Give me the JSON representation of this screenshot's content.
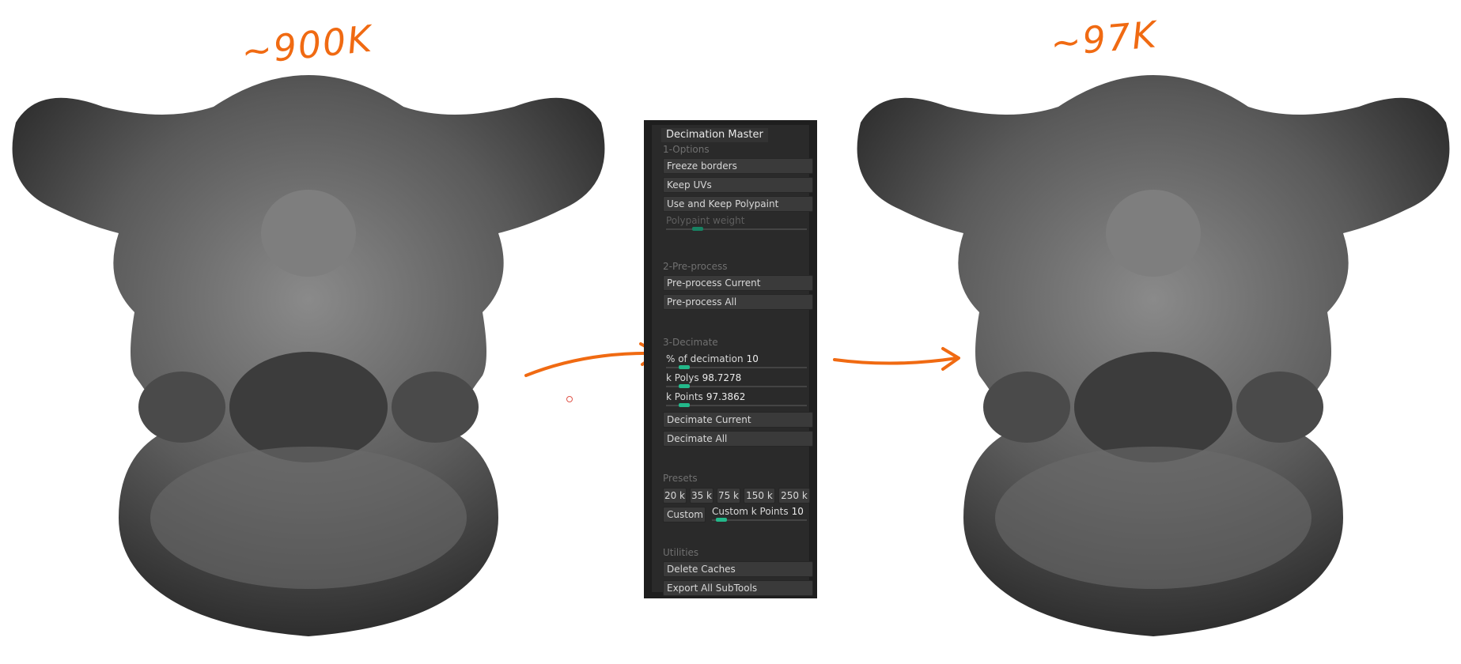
{
  "annotations": {
    "left": "~900K",
    "right": "~97K"
  },
  "colors": {
    "annotation": "#f06a12",
    "panel_bg": "#1e1e1e",
    "slider_accent": "#23b88a"
  },
  "panel": {
    "title": "Decimation Master",
    "sections": {
      "options": {
        "label": "1-Options",
        "freeze_borders": "Freeze borders",
        "keep_uvs": "Keep UVs",
        "use_keep_polypaint": "Use and Keep Polypaint",
        "polypaint_weight": "Polypaint weight"
      },
      "preprocess": {
        "label": "2-Pre-process",
        "current": "Pre-process Current",
        "all": "Pre-process All"
      },
      "decimate": {
        "label": "3-Decimate",
        "percent_label": "% of decimation",
        "percent_value": "10",
        "kpolys_label": "k Polys",
        "kpolys_value": "98.7278",
        "kpoints_label": "k Points",
        "kpoints_value": "97.3862",
        "current": "Decimate Current",
        "all": "Decimate All"
      },
      "presets": {
        "label": "Presets",
        "items": [
          "20 k",
          "35 k",
          "75 k",
          "150 k",
          "250 k"
        ],
        "custom": "Custom",
        "custom_points_label": "Custom k Points",
        "custom_points_value": "10"
      },
      "utilities": {
        "label": "Utilities",
        "delete_caches": "Delete Caches",
        "export_all": "Export All SubTools"
      }
    }
  },
  "slider_levels": {
    "polypaint_weight": 0.2,
    "percent": 0.1,
    "kpolys": 0.1,
    "kpoints": 0.1,
    "custom_points": 0.05
  }
}
